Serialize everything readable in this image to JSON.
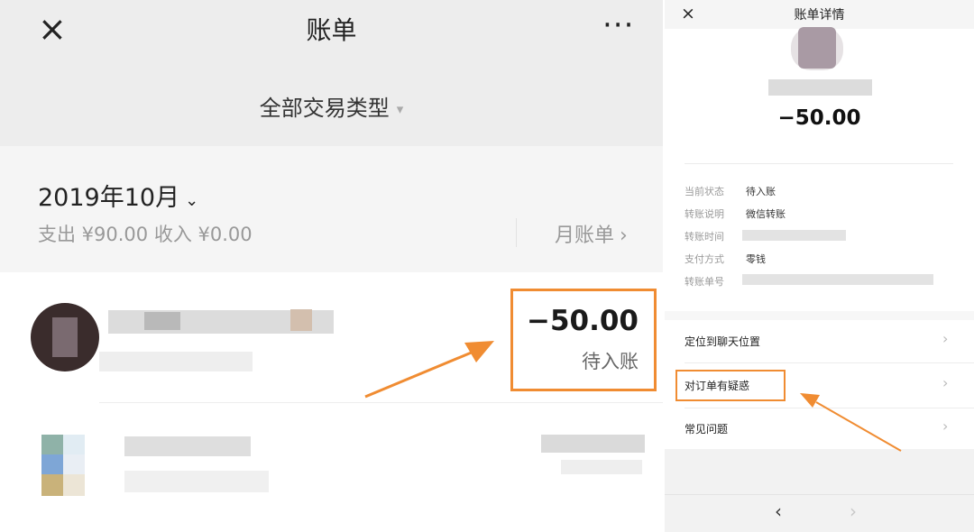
{
  "left": {
    "header": {
      "close_icon": "×",
      "title": "账单",
      "more_icon": "···"
    },
    "filter": {
      "label": "全部交易类型",
      "caret_icon": "▾"
    },
    "month_section": {
      "month": "2019年10月",
      "month_chevron": "⌄",
      "summary": "支出 ¥90.00 收入 ¥0.00",
      "monthly_bill_label": "月账单",
      "monthly_chevron": "›"
    },
    "transaction": {
      "amount": "−50.00",
      "status": "待入账"
    },
    "highlight_color": "#f08c32"
  },
  "right": {
    "header": {
      "close_icon": "×",
      "title": "账单详情"
    },
    "amount": "−50.00",
    "details": [
      {
        "label": "当前状态",
        "value": "待入账"
      },
      {
        "label": "转账说明",
        "value": "微信转账"
      },
      {
        "label": "转账时间",
        "value": ""
      },
      {
        "label": "支付方式",
        "value": "零钱"
      },
      {
        "label": "转账单号",
        "value": ""
      }
    ],
    "actions": [
      {
        "label": "定位到聊天位置",
        "chevron": "›"
      },
      {
        "label": "对订单有疑惑",
        "chevron": "›"
      },
      {
        "label": "常见问题",
        "chevron": "›"
      }
    ],
    "nav": {
      "back_icon": "‹",
      "forward_icon": "›"
    }
  }
}
